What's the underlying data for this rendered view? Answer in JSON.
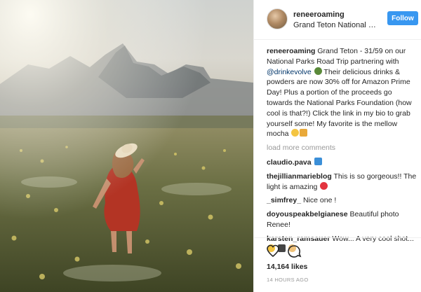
{
  "post": {
    "username": "reneeroaming",
    "location": "Grand Teton National P...",
    "follow_label": "Follow",
    "caption_user": "reneeroaming",
    "caption_part1": "Grand Teton - 31/59 on our National Parks Road Trip partnering with ",
    "caption_mention": "@drinkevolve",
    "caption_part2": " Their delicious drinks & powders are now 30% off for Amazon Prime Day! Plus a portion of the proceeds go towards the National Parks Foundation (how cool is that?!) Click the link in my bio to grab yourself some! My favorite is the mellow mocha ",
    "load_more": "load more comments",
    "comments": [
      {
        "user": "claudio.pava",
        "text": ""
      },
      {
        "user": "thejillianmarieblog",
        "text": "This is so gorgeous!! The light is amazing "
      },
      {
        "user": "_simfrey_",
        "text": "Nice one !"
      },
      {
        "user": "doyouspeakbelgianese",
        "text": "Beautiful photo Renee!"
      },
      {
        "user": "karsten_ramsauer",
        "text": "Wow... A very cool shot..."
      }
    ],
    "likes": "14,164 likes",
    "timestamp": "14 HOURS AGO",
    "colors": {
      "follow_bg": "#3897f0",
      "heart": "#ed4956",
      "link": "#003569",
      "muted": "#999999"
    },
    "icons": [
      "heart-icon",
      "comment-icon",
      "download-emoji-icon",
      "emoji-icon"
    ]
  }
}
